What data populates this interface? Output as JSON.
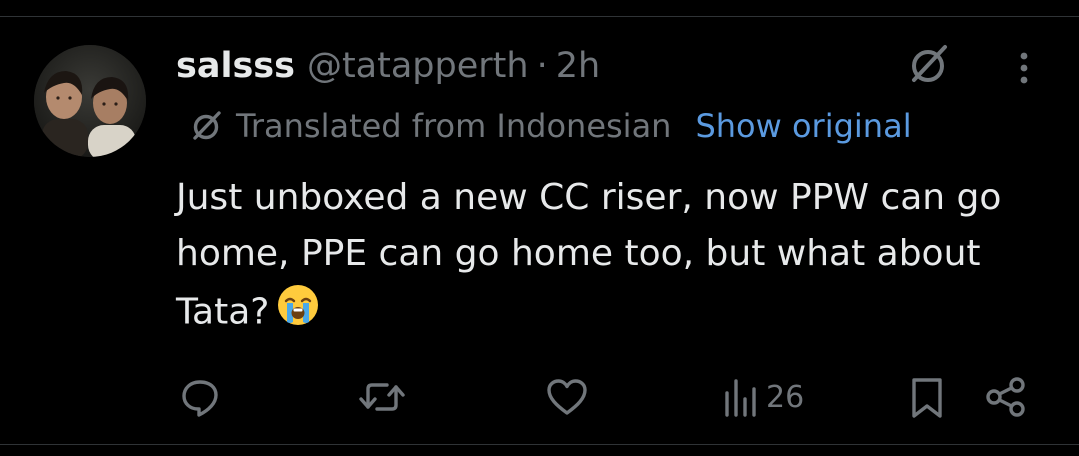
{
  "tweet": {
    "display_name": "salsss",
    "handle": "@tatapperth",
    "separator": "·",
    "time": "2h",
    "translated_label": "Translated from Indonesian",
    "show_original_label": "Show original",
    "text": "Just unboxed a new CC riser, now PPW can go home, PPE can go home too, but what about Tata?",
    "emoji": "loudly-crying-face",
    "views_count": "26"
  },
  "colors": {
    "background": "#000000",
    "primary_text": "#e7e9ea",
    "secondary_text": "#71767b",
    "link": "#5b9ae0",
    "divider": "#2f3336"
  },
  "icons": {
    "reply": "reply-icon",
    "retweet": "retweet-icon",
    "like": "heart-icon",
    "views": "views-icon",
    "bookmark": "bookmark-icon",
    "share": "share-icon",
    "grok": "grok-icon",
    "more": "more-icon",
    "translate": "grok-icon"
  }
}
